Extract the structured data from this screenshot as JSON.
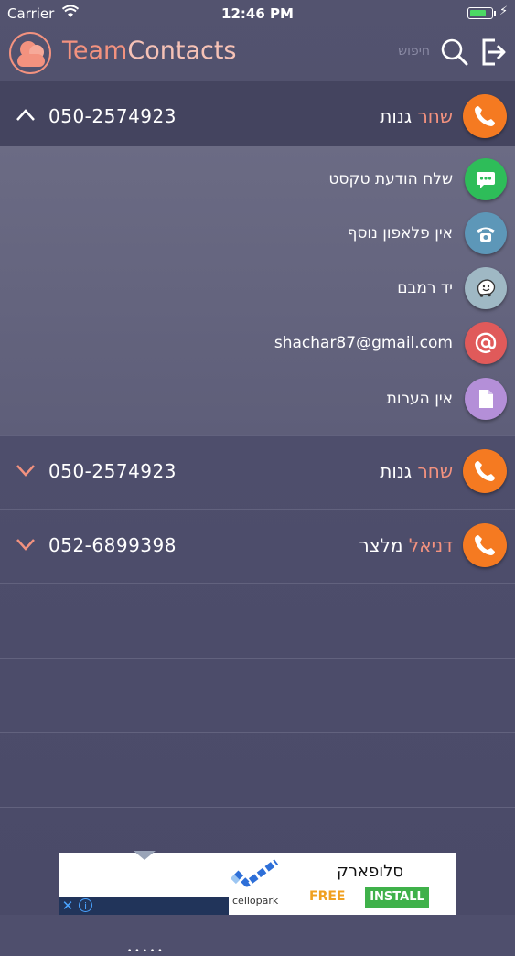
{
  "status_bar": {
    "carrier": "Carrier",
    "time": "12:46 PM"
  },
  "header": {
    "app_name_part1": "Team",
    "app_name_part2": "Contacts",
    "search_placeholder": "חיפוש"
  },
  "contacts": [
    {
      "first_name": "שחר",
      "last_name": "גנות",
      "phone": "050-2574923",
      "expanded": true
    },
    {
      "first_name": "שחר",
      "last_name": "גנות",
      "phone": "050-2574923",
      "expanded": false
    },
    {
      "first_name": "דניאל",
      "last_name": "מלצר",
      "phone": "052-6899398",
      "expanded": false
    }
  ],
  "details": {
    "sms": "שלח הודעת טקסט",
    "extra_phone": "אין פלאפון נוסף",
    "address": "יד רמבם",
    "email": "shachar87@gmail.com",
    "notes": "אין הערות"
  },
  "icon_colors": {
    "call": "#f57a21",
    "sms": "#2ebd59",
    "phone": "#5d97b8",
    "waze": "#9fb8c4",
    "email": "#e05a5a",
    "notes": "#b48fd8"
  },
  "ad": {
    "title": "סלופארק",
    "brand": "cellopark",
    "free_label": "FREE",
    "install_label": "INSTALL"
  }
}
